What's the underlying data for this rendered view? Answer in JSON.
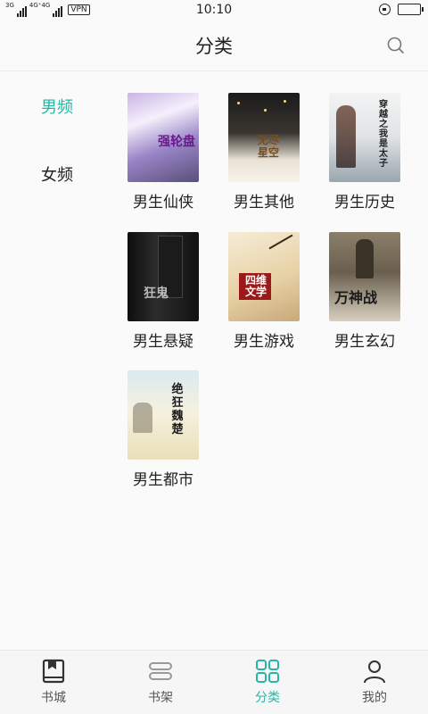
{
  "status_bar": {
    "network_left": "3G",
    "network_mid": "4G⁺4G",
    "vpn": "VPN",
    "time": "10:10"
  },
  "header": {
    "title": "分类",
    "search_icon": "search-icon"
  },
  "sidebar": {
    "items": [
      {
        "label": "男频",
        "active": true
      },
      {
        "label": "女频",
        "active": false
      }
    ]
  },
  "categories": [
    {
      "label": "男生仙侠",
      "cover_text": "强轮盘"
    },
    {
      "label": "男生其他",
      "cover_text": "无尽星空"
    },
    {
      "label": "男生历史",
      "cover_text": "穿越之我是太子"
    },
    {
      "label": "男生悬疑",
      "cover_text": "狂鬼"
    },
    {
      "label": "男生游戏",
      "cover_text": "四维文学"
    },
    {
      "label": "男生玄幻",
      "cover_text": "万神战"
    },
    {
      "label": "男生都市",
      "cover_text": "绝狂魏楚"
    }
  ],
  "bottom_nav": {
    "items": [
      {
        "label": "书城",
        "icon": "book-icon",
        "active": false
      },
      {
        "label": "书架",
        "icon": "bookshelf-icon",
        "active": false
      },
      {
        "label": "分类",
        "icon": "grid-icon",
        "active": true
      },
      {
        "label": "我的",
        "icon": "person-icon",
        "active": false
      }
    ]
  },
  "colors": {
    "accent": "#26b6a4",
    "text": "#222222",
    "background": "#fafafa"
  }
}
